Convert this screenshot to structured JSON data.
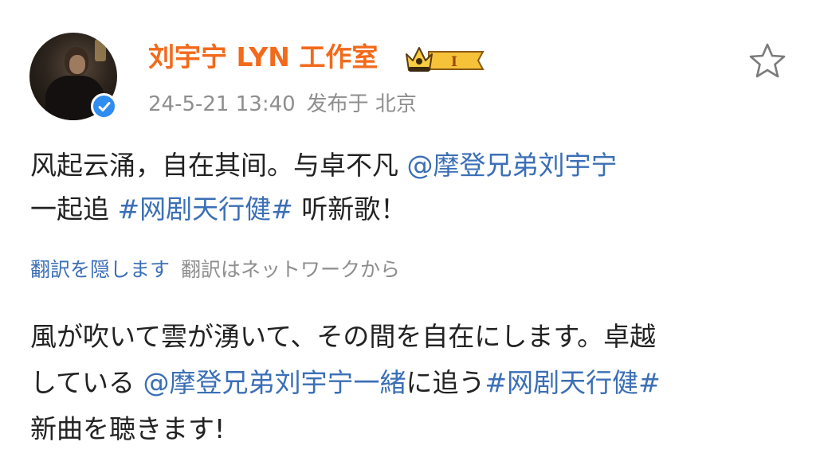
{
  "user": {
    "name": "刘宇宁 LYN 工作室",
    "badge_level": "I"
  },
  "meta": {
    "time": "24-5-21 13:40",
    "location": "发布于 北京"
  },
  "post": {
    "line1_text": "风起云涌，自在其间。与卓不凡 ",
    "line1_mention": "@摩登兄弟刘宇宁",
    "line2_text": "一起追 ",
    "line2_hashtag": "#网剧天行健#",
    "line2_tail": " 听新歌！"
  },
  "translation": {
    "hide_label": "翻訳を隠します",
    "source_label": "翻訳はネットワークから",
    "line1": "風が吹いて雲が湧いて、その間を自在にします。卓越",
    "line2_text": "している ",
    "line2_mention": "@摩登兄弟刘宇宁一緒",
    "line2_mid": "に追う",
    "line2_hashtag": "#网剧天行健#",
    "line3": "新曲を聴きます!"
  },
  "colors": {
    "username": "#f26a1b",
    "link": "#3b6fb6",
    "meta": "#8e8e8e",
    "verified": "#2f8cf0"
  },
  "icons": {
    "verified": "verified-check-icon",
    "badge": "crown-badge-icon",
    "favorite": "star-outline-icon"
  }
}
